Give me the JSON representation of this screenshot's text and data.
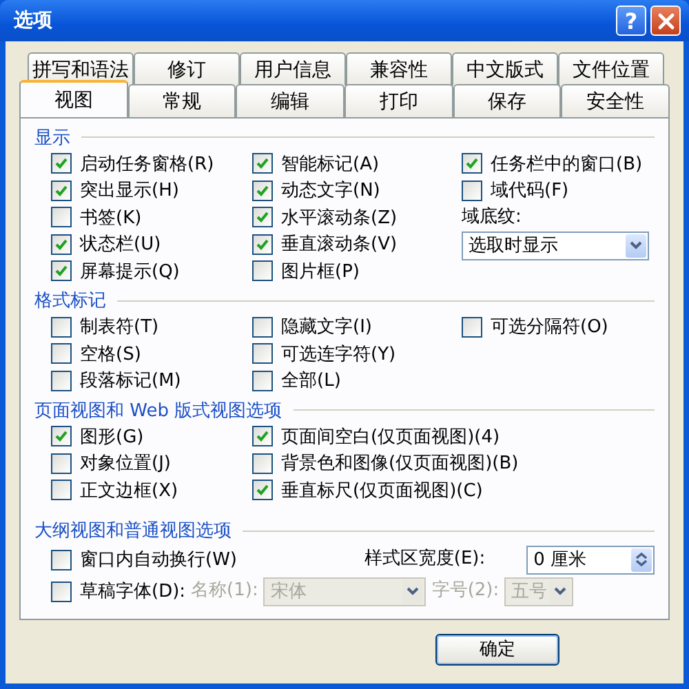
{
  "window": {
    "title": "选项",
    "help_button": "?"
  },
  "tab_rows": [
    [
      {
        "label": "拼写和语法",
        "selected": false
      },
      {
        "label": "修订",
        "selected": false
      },
      {
        "label": "用户信息",
        "selected": false
      },
      {
        "label": "兼容性",
        "selected": false
      },
      {
        "label": "中文版式",
        "selected": false
      },
      {
        "label": "文件位置",
        "selected": false
      }
    ],
    [
      {
        "label": "视图",
        "selected": true
      },
      {
        "label": "常规",
        "selected": false
      },
      {
        "label": "编辑",
        "selected": false
      },
      {
        "label": "打印",
        "selected": false
      },
      {
        "label": "保存",
        "selected": false
      },
      {
        "label": "安全性",
        "selected": false
      }
    ]
  ],
  "grid_sections": [
    {
      "title": "显示",
      "columns": [
        [
          {
            "kind": "checkbox",
            "label": "启动任务窗格(R)",
            "checked": true
          },
          {
            "kind": "checkbox",
            "label": "突出显示(H)",
            "checked": true
          },
          {
            "kind": "checkbox",
            "label": "书签(K)",
            "checked": false
          },
          {
            "kind": "checkbox",
            "label": "状态栏(U)",
            "checked": true
          },
          {
            "kind": "checkbox",
            "label": "屏幕提示(Q)",
            "checked": true
          }
        ],
        [
          {
            "kind": "checkbox",
            "label": "智能标记(A)",
            "checked": true
          },
          {
            "kind": "checkbox",
            "label": "动态文字(N)",
            "checked": true
          },
          {
            "kind": "checkbox",
            "label": "水平滚动条(Z)",
            "checked": true
          },
          {
            "kind": "checkbox",
            "label": "垂直滚动条(V)",
            "checked": true
          },
          {
            "kind": "checkbox",
            "label": "图片框(P)",
            "checked": false
          }
        ],
        [
          {
            "kind": "checkbox",
            "label": "任务栏中的窗口(B)",
            "checked": true
          },
          {
            "kind": "checkbox",
            "label": "域代码(F)",
            "checked": false
          },
          {
            "kind": "label",
            "label": "域底纹:",
            "disabled": false
          },
          {
            "kind": "dropdown",
            "value": "选取时显示",
            "disabled": false
          }
        ]
      ]
    },
    {
      "title": "格式标记",
      "columns": [
        [
          {
            "kind": "checkbox",
            "label": "制表符(T)",
            "checked": false
          },
          {
            "kind": "checkbox",
            "label": "空格(S)",
            "checked": false
          },
          {
            "kind": "checkbox",
            "label": "段落标记(M)",
            "checked": false
          }
        ],
        [
          {
            "kind": "checkbox",
            "label": "隐藏文字(I)",
            "checked": false
          },
          {
            "kind": "checkbox",
            "label": "可选连字符(Y)",
            "checked": false
          },
          {
            "kind": "checkbox",
            "label": "全部(L)",
            "checked": false
          }
        ],
        [
          {
            "kind": "checkbox",
            "label": "可选分隔符(O)",
            "checked": false
          }
        ]
      ]
    },
    {
      "title": "页面视图和 Web 版式视图选项",
      "columns": [
        [
          {
            "kind": "checkbox",
            "label": "图形(G)",
            "checked": true
          },
          {
            "kind": "checkbox",
            "label": "对象位置(J)",
            "checked": false
          },
          {
            "kind": "checkbox",
            "label": "正文边框(X)",
            "checked": false
          }
        ],
        [
          {
            "kind": "checkbox",
            "label": "页面间空白(仅页面视图)(4)",
            "checked": true
          },
          {
            "kind": "checkbox",
            "label": "背景色和图像(仅页面视图)(B)",
            "checked": false
          },
          {
            "kind": "checkbox",
            "label": "垂直标尺(仅页面视图)(C)",
            "checked": true
          }
        ]
      ]
    }
  ],
  "outline_section": {
    "title": "大纲视图和普通视图选项",
    "wrap_checkbox": {
      "label": "窗口内自动换行(W)",
      "checked": false
    },
    "style_area_width": {
      "label": "样式区宽度(E):",
      "value": "0 厘米"
    },
    "draft_font_checkbox": {
      "label": "草稿字体(D):",
      "checked": false
    },
    "font_name": {
      "label": "名称(1):",
      "value": "宋体",
      "disabled": true
    },
    "font_size": {
      "label": "字号(2):",
      "value": "五号",
      "disabled": true
    }
  },
  "buttons": [
    "确定"
  ]
}
